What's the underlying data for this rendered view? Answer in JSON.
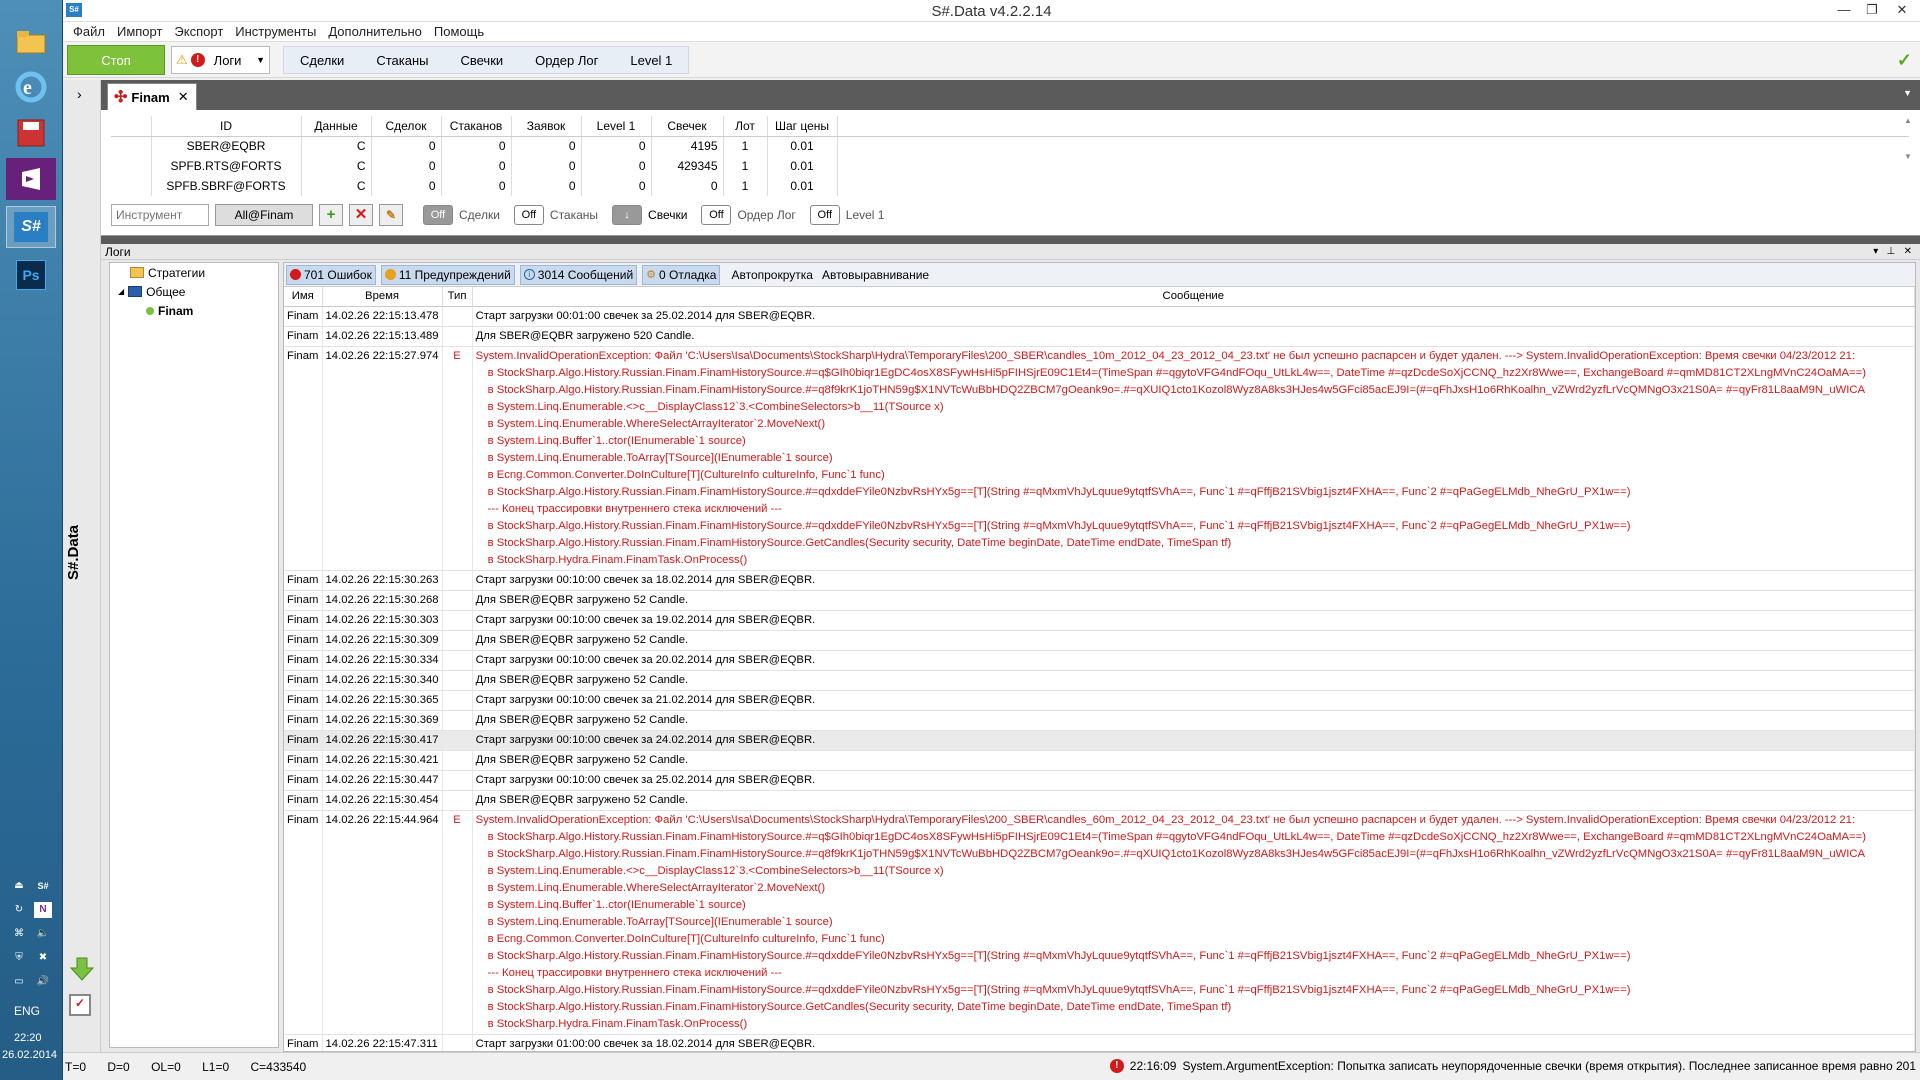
{
  "window": {
    "title": "S#.Data v4.2.2.14"
  },
  "taskbar": {
    "lang": "ENG",
    "time": "22:20",
    "date": "26.02.2014"
  },
  "menu": [
    "Файл",
    "Импорт",
    "Экспорт",
    "Инструменты",
    "Дополнительно",
    "Помощь"
  ],
  "ribbon": {
    "stop_label": "Стоп",
    "logs_label": "Логи",
    "tabs": [
      "Сделки",
      "Стаканы",
      "Свечки",
      "Ордер Лог",
      "Level 1"
    ]
  },
  "sidebar": {
    "vertical_title": "S#.Data"
  },
  "doc_tab": {
    "label": "Finam"
  },
  "securities": {
    "headers": [
      "ID",
      "Данные",
      "Сделок",
      "Стаканов",
      "Заявок",
      "Level 1",
      "Свечек",
      "Лот",
      "Шаг цены"
    ],
    "rows": [
      [
        "SBER@EQBR",
        "C",
        "0",
        "0",
        "0",
        "0",
        "4195",
        "1",
        "0.01"
      ],
      [
        "SPFB.RTS@FORTS",
        "C",
        "0",
        "0",
        "0",
        "0",
        "429345",
        "1",
        "0.01"
      ],
      [
        "SPFB.SBRF@FORTS",
        "C",
        "0",
        "0",
        "0",
        "0",
        "0",
        "1",
        "0.01"
      ]
    ],
    "instrument_placeholder": "Инструмент",
    "source": "All@Finam",
    "toggles": [
      {
        "state": "Off",
        "label": "Сделки"
      },
      {
        "state": "Off",
        "label": "Стаканы"
      },
      {
        "state": "↓",
        "label": "Свечки"
      },
      {
        "state": "Off",
        "label": "Ордер Лог"
      },
      {
        "state": "Off",
        "label": "Level 1"
      }
    ]
  },
  "logs": {
    "title": "Логи",
    "tree": {
      "strategies": "Стратегии",
      "general": "Общее",
      "finam": "Finam"
    },
    "filters": {
      "errors": "701 Ошибок",
      "warnings": "11 Предупреждений",
      "messages": "3014 Сообщений",
      "debug": "0 Отладка",
      "autoscroll": "Автопрокрутка",
      "autoalign": "Автовыравнивание"
    },
    "headers": [
      "Имя",
      "Время",
      "Тип",
      "Сообщение"
    ],
    "rows": [
      {
        "name": "Finam",
        "time": "14.02.26 22:15:13.478",
        "type": "",
        "msg": "Старт загрузки 00:01:00 свечек за 25.02.2014 для SBER@EQBR."
      },
      {
        "name": "Finam",
        "time": "14.02.26 22:15:13.489",
        "type": "",
        "msg": "Для SBER@EQBR загружено 520 Candle."
      },
      {
        "name": "Finam",
        "time": "14.02.26 22:15:27.974",
        "type": "E",
        "msg": "System.InvalidOperationException: Файл 'C:\\Users\\Isa\\Documents\\StockSharp\\Hydra\\TemporaryFiles\\200_SBER\\candles_10m_2012_04_23_2012_04_23.txt' не был успешно распарсен и будет удален. ---> System.InvalidOperationException: Время свечки 04/23/2012 21:",
        "trace": [
          "в StockSharp.Algo.History.Russian.Finam.FinamHistorySource.#=q$GIh0biqr1EgDC4osX8SFywHsHi5pFIHSjrE09C1Et4=(TimeSpan #=qgytoVFG4ndFOqu_UtLkL4w==, DateTime #=qzDcdeSoXjCCNQ_hz2Xr8Wwe==, ExchangeBoard #=qmMD81CT2XLngMVnC24OaMA==)",
          "в StockSharp.Algo.History.Russian.Finam.FinamHistorySource.#=q8f9krK1joTHN59g$X1NVTcWuBbHDQ2ZBCM7gOeank9o=.#=qXUIQ1cto1Kozol8Wyz8A8ks3HJes4w5GFci85acEJ9I=(#=qFhJxsH1o6RhKoalhn_vZWrd2yzfLrVcQMNgO3x21S0A= #=qyFr81L8aaM9N_uWICA",
          "в System.Linq.Enumerable.<>c__DisplayClass12`3.<CombineSelectors>b__11(TSource x)",
          "в System.Linq.Enumerable.WhereSelectArrayIterator`2.MoveNext()",
          "в System.Linq.Buffer`1..ctor(IEnumerable`1 source)",
          "в System.Linq.Enumerable.ToArray[TSource](IEnumerable`1 source)",
          "в Ecng.Common.Converter.DoInCulture[T](CultureInfo cultureInfo, Func`1 func)",
          "в StockSharp.Algo.History.Russian.Finam.FinamHistorySource.#=qdxddeFYile0NzbvRsHYx5g==[T](String #=qMxmVhJyLquue9ytqtfSVhA==, Func`1 #=qFffjB21SVbig1jszt4FXHA==, Func`2 #=qPaGegELMdb_NheGrU_PX1w==)",
          "--- Конец трассировки внутреннего стека исключений ---",
          "в StockSharp.Algo.History.Russian.Finam.FinamHistorySource.#=qdxddeFYile0NzbvRsHYx5g==[T](String #=qMxmVhJyLquue9ytqtfSVhA==, Func`1 #=qFffjB21SVbig1jszt4FXHA==, Func`2 #=qPaGegELMdb_NheGrU_PX1w==)",
          "в StockSharp.Algo.History.Russian.Finam.FinamHistorySource.GetCandles(Security security, DateTime beginDate, DateTime endDate, TimeSpan tf)",
          "в StockSharp.Hydra.Finam.FinamTask.OnProcess()"
        ]
      },
      {
        "name": "Finam",
        "time": "14.02.26 22:15:30.263",
        "type": "",
        "msg": "Старт загрузки 00:10:00 свечек за 18.02.2014 для SBER@EQBR."
      },
      {
        "name": "Finam",
        "time": "14.02.26 22:15:30.268",
        "type": "",
        "msg": "Для SBER@EQBR загружено 52 Candle."
      },
      {
        "name": "Finam",
        "time": "14.02.26 22:15:30.303",
        "type": "",
        "msg": "Старт загрузки 00:10:00 свечек за 19.02.2014 для SBER@EQBR."
      },
      {
        "name": "Finam",
        "time": "14.02.26 22:15:30.309",
        "type": "",
        "msg": "Для SBER@EQBR загружено 52 Candle."
      },
      {
        "name": "Finam",
        "time": "14.02.26 22:15:30.334",
        "type": "",
        "msg": "Старт загрузки 00:10:00 свечек за 20.02.2014 для SBER@EQBR."
      },
      {
        "name": "Finam",
        "time": "14.02.26 22:15:30.340",
        "type": "",
        "msg": "Для SBER@EQBR загружено 52 Candle."
      },
      {
        "name": "Finam",
        "time": "14.02.26 22:15:30.365",
        "type": "",
        "msg": "Старт загрузки 00:10:00 свечек за 21.02.2014 для SBER@EQBR."
      },
      {
        "name": "Finam",
        "time": "14.02.26 22:15:30.369",
        "type": "",
        "msg": "Для SBER@EQBR загружено 52 Candle."
      },
      {
        "name": "Finam",
        "time": "14.02.26 22:15:30.417",
        "type": "",
        "msg": "Старт загрузки 00:10:00 свечек за 24.02.2014 для SBER@EQBR.",
        "highlight": true
      },
      {
        "name": "Finam",
        "time": "14.02.26 22:15:30.421",
        "type": "",
        "msg": "Для SBER@EQBR загружено 52 Candle."
      },
      {
        "name": "Finam",
        "time": "14.02.26 22:15:30.447",
        "type": "",
        "msg": "Старт загрузки 00:10:00 свечек за 25.02.2014 для SBER@EQBR."
      },
      {
        "name": "Finam",
        "time": "14.02.26 22:15:30.454",
        "type": "",
        "msg": "Для SBER@EQBR загружено 52 Candle."
      },
      {
        "name": "Finam",
        "time": "14.02.26 22:15:44.964",
        "type": "E",
        "msg": "System.InvalidOperationException: Файл 'C:\\Users\\Isa\\Documents\\StockSharp\\Hydra\\TemporaryFiles\\200_SBER\\candles_60m_2012_04_23_2012_04_23.txt' не был успешно распарсен и будет удален. ---> System.InvalidOperationException: Время свечки 04/23/2012 21:",
        "trace": [
          "в StockSharp.Algo.History.Russian.Finam.FinamHistorySource.#=q$GIh0biqr1EgDC4osX8SFywHsHi5pFIHSjrE09C1Et4=(TimeSpan #=qgytoVFG4ndFOqu_UtLkL4w==, DateTime #=qzDcdeSoXjCCNQ_hz2Xr8Wwe==, ExchangeBoard #=qmMD81CT2XLngMVnC24OaMA==)",
          "в StockSharp.Algo.History.Russian.Finam.FinamHistorySource.#=q8f9krK1joTHN59g$X1NVTcWuBbHDQ2ZBCM7gOeank9o=.#=qXUIQ1cto1Kozol8Wyz8A8ks3HJes4w5GFci85acEJ9I=(#=qFhJxsH1o6RhKoalhn_vZWrd2yzfLrVcQMNgO3x21S0A= #=qyFr81L8aaM9N_uWICA",
          "в System.Linq.Enumerable.<>c__DisplayClass12`3.<CombineSelectors>b__11(TSource x)",
          "в System.Linq.Enumerable.WhereSelectArrayIterator`2.MoveNext()",
          "в System.Linq.Buffer`1..ctor(IEnumerable`1 source)",
          "в System.Linq.Enumerable.ToArray[TSource](IEnumerable`1 source)",
          "в Ecng.Common.Converter.DoInCulture[T](CultureInfo cultureInfo, Func`1 func)",
          "в StockSharp.Algo.History.Russian.Finam.FinamHistorySource.#=qdxddeFYile0NzbvRsHYx5g==[T](String #=qMxmVhJyLquue9ytqtfSVhA==, Func`1 #=qFffjB21SVbig1jszt4FXHA==, Func`2 #=qPaGegELMdb_NheGrU_PX1w==)",
          "--- Конец трассировки внутреннего стека исключений ---",
          "в StockSharp.Algo.History.Russian.Finam.FinamHistorySource.#=qdxddeFYile0NzbvRsHYx5g==[T](String #=qMxmVhJyLquue9ytqtfSVhA==, Func`1 #=qFffjB21SVbig1jszt4FXHA==, Func`2 #=qPaGegELMdb_NheGrU_PX1w==)",
          "в StockSharp.Algo.History.Russian.Finam.FinamHistorySource.GetCandles(Security security, DateTime beginDate, DateTime endDate, TimeSpan tf)",
          "в StockSharp.Hydra.Finam.FinamTask.OnProcess()"
        ]
      },
      {
        "name": "Finam",
        "time": "14.02.26 22:15:47.311",
        "type": "",
        "msg": "Старт загрузки 01:00:00 свечек за 18.02.2014 для SBER@EQBR."
      }
    ]
  },
  "status": {
    "t": "T=0",
    "d": "D=0",
    "ol": "OL=0",
    "l1": "L1=0",
    "c": "C=433540",
    "last_time": "22:16:09",
    "last_msg": "System.ArgumentException: Попытка записать неупорядоченные свечки (время открытия). Последнее записанное время равно 201"
  },
  "colors": {
    "error": "#d21a1a",
    "stop_green": "#7dc23a",
    "dark_bar": "#5b5b5b"
  }
}
